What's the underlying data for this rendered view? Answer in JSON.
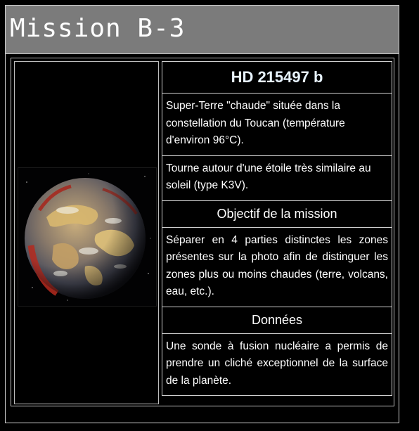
{
  "header": {
    "title": "Mission B-3"
  },
  "planet": {
    "name": "HD 215497 b",
    "description_1": "Super-Terre \"chaude\" située dans la constellation  du Toucan (température d'environ 96°C).",
    "description_2": "Tourne autour d'une étoile très similaire au soleil (type K3V).",
    "image_alt": "planet-image"
  },
  "objective": {
    "heading": "Objectif de la mission",
    "text": "Séparer en 4 parties distinctes les zones présentes sur la photo afin de distinguer les zones plus ou moins chaudes (terre, volcans, eau, etc.)."
  },
  "data_section": {
    "heading": "Données",
    "text": "Une sonde à fusion nucléaire a permis de prendre un cliché exceptionnel de la surface de la planète."
  },
  "colors": {
    "title_bar": "#7b7b7b",
    "background": "#000000",
    "border": "#cfcfcf",
    "planet_title": "#e8f4ff"
  }
}
